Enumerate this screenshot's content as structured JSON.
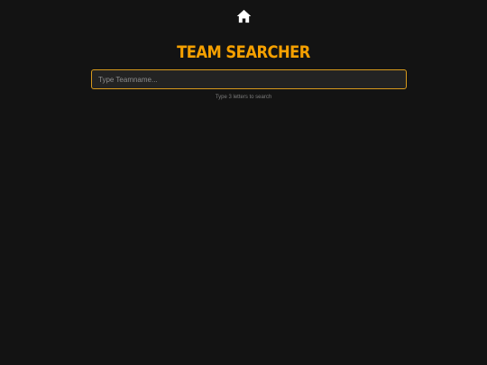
{
  "nav": {
    "home_icon": "home-icon",
    "icon_color": "#ffffff"
  },
  "header": {
    "title": "Team Searcher"
  },
  "search": {
    "value": "",
    "placeholder": "Type Teamname...",
    "hint": "Type 3 letters to search"
  },
  "colors": {
    "background": "#131313",
    "accent": "#f5a000",
    "input_background": "#232323",
    "input_border": "#d89a1c"
  }
}
